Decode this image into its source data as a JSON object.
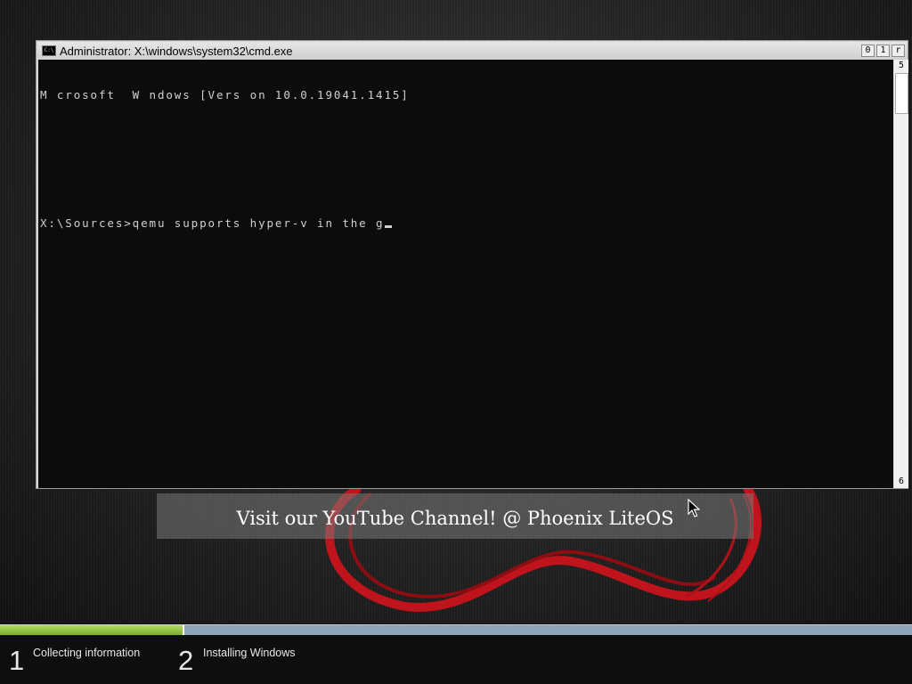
{
  "window": {
    "title": "Administrator: X:\\windows\\system32\\cmd.exe",
    "icon": "cmd-icon",
    "buttons": {
      "minimize": "0",
      "maximize": "1",
      "close": "r"
    }
  },
  "console": {
    "lines": [
      "M crosoft  W ndows [Vers on 10.0.19041.1415]",
      "",
      "",
      "X:\\Sources>qemu supports hyper-v in the g"
    ]
  },
  "scrollbar": {
    "up": "5",
    "down": "6"
  },
  "banner": {
    "text": "Visit our YouTube Channel! @ Phoenix LiteOS"
  },
  "setup": {
    "progress": 0.2,
    "steps": [
      {
        "number": "1",
        "label": "Collecting information"
      },
      {
        "number": "2",
        "label": "Installing Windows"
      }
    ]
  },
  "colors": {
    "progress_fill": "#8dbf3a",
    "progress_track": "#8ea3b9",
    "console_bg": "#0c0c0c",
    "console_fg": "#d0d0d0",
    "swirl": "#c0141c"
  }
}
